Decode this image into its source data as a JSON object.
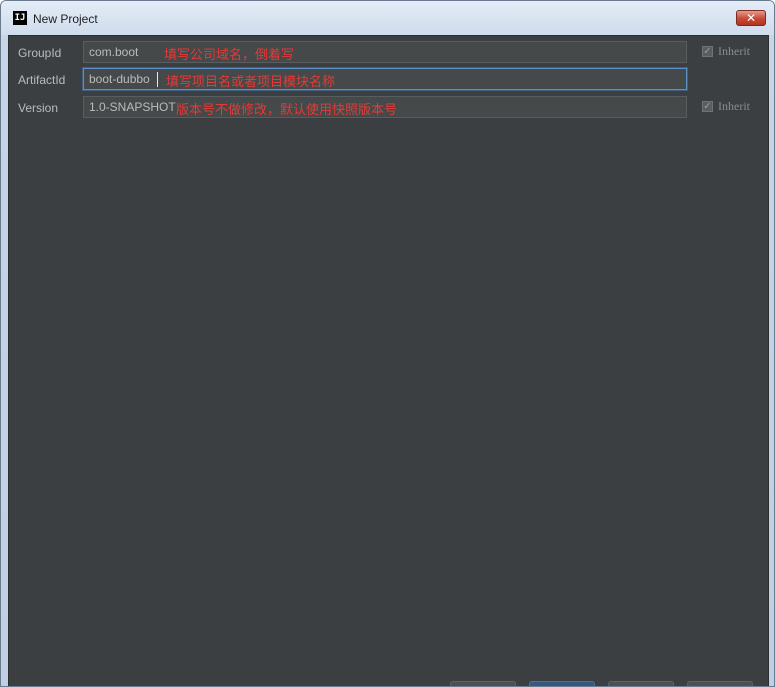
{
  "window": {
    "title": "New Project",
    "icon_text": "IJ",
    "close_glyph": "✕"
  },
  "form": {
    "group_id": {
      "label": "GroupId",
      "value": "com.boot",
      "annotation": "填写公司域名，倒着写",
      "inherit_label": "Inherit",
      "inherit_checked": true
    },
    "artifact_id": {
      "label": "ArtifactId",
      "value": "boot-dubbo",
      "annotation": "填写项目名或者项目模块名称"
    },
    "version": {
      "label": "Version",
      "value": "1.0-SNAPSHOT",
      "annotation": "版本号不做修改，默认使用快照版本号",
      "inherit_label": "Inherit",
      "inherit_checked": true
    }
  },
  "colors": {
    "annotation": "#e53a35",
    "panel_background": "#3c3f41",
    "focus_border": "#5b8fc7"
  }
}
